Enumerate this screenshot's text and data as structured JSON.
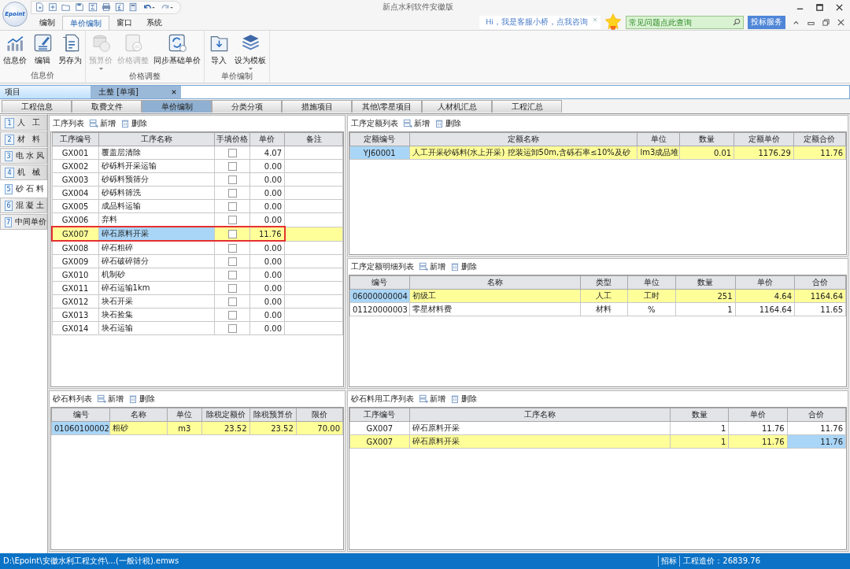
{
  "window": {
    "title": "新点水利软件安徽版"
  },
  "logo": "Epoint",
  "ribbon_tabs": [
    {
      "label": "编制",
      "selected": false
    },
    {
      "label": "单价编制",
      "selected": true
    },
    {
      "label": "窗口",
      "selected": false
    },
    {
      "label": "系统",
      "selected": false
    }
  ],
  "assistant": {
    "message": "Hi，我是客服小桥，点我咨询"
  },
  "search": {
    "placeholder": "常见问题点此查询"
  },
  "service_button": "投标服务",
  "ribbon_groups": [
    {
      "label": "信息价",
      "buttons": [
        {
          "label": "信息价",
          "disabled": false,
          "dropdown": false
        },
        {
          "label": "编辑",
          "disabled": false,
          "dropdown": false
        },
        {
          "label": "另存为",
          "disabled": false,
          "dropdown": false
        }
      ]
    },
    {
      "label": "价格调整",
      "buttons": [
        {
          "label": "预算价",
          "disabled": true,
          "dropdown": true
        },
        {
          "label": "价格调整",
          "disabled": true,
          "dropdown": false
        },
        {
          "label": "同步基础单价",
          "disabled": false,
          "dropdown": false
        }
      ]
    },
    {
      "label": "单价编制",
      "buttons": [
        {
          "label": "导入",
          "disabled": false,
          "dropdown": false
        },
        {
          "label": "设为模板",
          "disabled": false,
          "dropdown": true
        }
      ]
    }
  ],
  "doc_tabs": [
    {
      "label": "项目",
      "selected": false,
      "closable": false
    },
    {
      "label": "土整 [单项]",
      "selected": true,
      "closable": true
    }
  ],
  "sub_tabs": [
    {
      "label": "工程信息",
      "selected": false
    },
    {
      "label": "取费文件",
      "selected": false
    },
    {
      "label": "单价编制",
      "selected": true
    },
    {
      "label": "分类分项",
      "selected": false
    },
    {
      "label": "措施项目",
      "selected": false
    },
    {
      "label": "其他\\零星项目",
      "selected": false
    },
    {
      "label": "人材机汇总",
      "selected": false
    },
    {
      "label": "工程汇总",
      "selected": false
    }
  ],
  "side_tabs": [
    {
      "number": "1",
      "label": "人 工",
      "selected": false
    },
    {
      "number": "2",
      "label": "材 料",
      "selected": false
    },
    {
      "number": "3",
      "label": "电水风",
      "selected": false
    },
    {
      "number": "4",
      "label": "机 械",
      "selected": false
    },
    {
      "number": "5",
      "label": "砂石料",
      "selected": true
    },
    {
      "number": "6",
      "label": "混凝土",
      "selected": false
    },
    {
      "number": "7",
      "label": "中间单价",
      "selected": false
    }
  ],
  "process_list": {
    "title": "工序列表",
    "add": "新增",
    "delete": "删除",
    "columns": [
      "工序编号",
      "工序名称",
      "手填价格",
      "单价",
      "备注"
    ],
    "rows": [
      {
        "selected": false,
        "outlined": false,
        "cells": [
          {
            "text": "GX001",
            "focused": false
          },
          {
            "text": "覆盖层清除",
            "focused": false
          },
          {
            "checked": false
          },
          {
            "text": "4.07",
            "focused": false
          }
        ]
      },
      {
        "selected": false,
        "outlined": false,
        "cells": [
          {
            "text": "GX002",
            "focused": false
          },
          {
            "text": "砂砾料开采运输",
            "focused": false
          },
          {
            "checked": false
          },
          {
            "text": "0.00",
            "focused": false
          }
        ]
      },
      {
        "selected": false,
        "outlined": false,
        "cells": [
          {
            "text": "GX003",
            "focused": false
          },
          {
            "text": "砂砾料预筛分",
            "focused": false
          },
          {
            "checked": false
          },
          {
            "text": "0.00",
            "focused": false
          }
        ]
      },
      {
        "selected": false,
        "outlined": false,
        "cells": [
          {
            "text": "GX004",
            "focused": false
          },
          {
            "text": "砂砾料筛洗",
            "focused": false
          },
          {
            "checked": false
          },
          {
            "text": "0.00",
            "focused": false
          }
        ]
      },
      {
        "selected": false,
        "outlined": false,
        "cells": [
          {
            "text": "GX005",
            "focused": false
          },
          {
            "text": "成品料运输",
            "focused": false
          },
          {
            "checked": false
          },
          {
            "text": "0.00",
            "focused": false
          }
        ]
      },
      {
        "selected": false,
        "outlined": false,
        "cells": [
          {
            "text": "GX006",
            "focused": false
          },
          {
            "text": "弃料",
            "focused": false
          },
          {
            "checked": false
          },
          {
            "text": "0.00",
            "focused": false
          }
        ]
      },
      {
        "selected": true,
        "outlined": true,
        "cells": [
          {
            "text": "GX007",
            "focused": false
          },
          {
            "text": "碎石原料开采",
            "focused": true
          },
          {
            "checked": false
          },
          {
            "text": "11.76",
            "focused": false
          }
        ]
      },
      {
        "selected": false,
        "outlined": false,
        "cells": [
          {
            "text": "GX008",
            "focused": false
          },
          {
            "text": "碎石粗碎",
            "focused": false
          },
          {
            "checked": false
          },
          {
            "text": "0.00",
            "focused": false
          }
        ]
      },
      {
        "selected": false,
        "outlined": false,
        "cells": [
          {
            "text": "GX009",
            "focused": false
          },
          {
            "text": "碎石破碎筛分",
            "focused": false
          },
          {
            "checked": false
          },
          {
            "text": "0.00",
            "focused": false
          }
        ]
      },
      {
        "selected": false,
        "outlined": false,
        "cells": [
          {
            "text": "GX010",
            "focused": false
          },
          {
            "text": "机制砂",
            "focused": false
          },
          {
            "checked": false
          },
          {
            "text": "0.00",
            "focused": false
          }
        ]
      },
      {
        "selected": false,
        "outlined": false,
        "cells": [
          {
            "text": "GX011",
            "focused": false
          },
          {
            "text": "碎石运输1km",
            "focused": false
          },
          {
            "checked": false
          },
          {
            "text": "0.00",
            "focused": false
          }
        ]
      },
      {
        "selected": false,
        "outlined": false,
        "cells": [
          {
            "text": "GX012",
            "focused": false
          },
          {
            "text": "块石开采",
            "focused": false
          },
          {
            "checked": false
          },
          {
            "text": "0.00",
            "focused": false
          }
        ]
      },
      {
        "selected": false,
        "outlined": false,
        "cells": [
          {
            "text": "GX013",
            "focused": false
          },
          {
            "text": "块石捡集",
            "focused": false
          },
          {
            "checked": false
          },
          {
            "text": "0.00",
            "focused": false
          }
        ]
      },
      {
        "selected": false,
        "outlined": false,
        "cells": [
          {
            "text": "GX014",
            "focused": false
          },
          {
            "text": "块石运输",
            "focused": false
          },
          {
            "checked": false
          },
          {
            "text": "0.00",
            "focused": false
          }
        ]
      }
    ]
  },
  "quota_list": {
    "title": "工序定额列表",
    "add": "新增",
    "delete": "删除",
    "columns": [
      "定额编号",
      "定额名称",
      "单位",
      "数量",
      "定额单价",
      "定额合价"
    ],
    "rows": [
      {
        "selected": true,
        "cells": [
          {
            "text": "YJ60001",
            "focused": true
          },
          {
            "text": "人工开采砂砾料(水上开采) 挖装运卸50m,含砾石率≤10%及砂",
            "focused": false
          },
          {
            "text": "lm3成品堆",
            "focused": false
          },
          {
            "text": "0.01",
            "focused": false
          },
          {
            "text": "1176.29",
            "focused": false
          },
          {
            "text": "11.76",
            "focused": false
          }
        ]
      }
    ]
  },
  "quota_detail_list": {
    "title": "工序定额明细列表",
    "add": "新增",
    "delete": "删除",
    "columns": [
      "编号",
      "名称",
      "类型",
      "单位",
      "数量",
      "单价",
      "合价"
    ],
    "rows": [
      {
        "selected": true,
        "cells": [
          {
            "text": "06000000004",
            "focused": true
          },
          {
            "text": "初级工",
            "focused": false
          },
          {
            "text": "人工",
            "focused": false
          },
          {
            "text": "工时",
            "focused": false
          },
          {
            "text": "251",
            "focused": false
          },
          {
            "text": "4.64",
            "focused": false
          },
          {
            "text": "1164.64",
            "focused": false
          }
        ]
      },
      {
        "selected": false,
        "cells": [
          {
            "text": "01120000003",
            "focused": false
          },
          {
            "text": "零星材料费",
            "focused": false
          },
          {
            "text": "材料",
            "focused": false
          },
          {
            "text": "%",
            "focused": false
          },
          {
            "text": "1",
            "focused": false
          },
          {
            "text": "1164.64",
            "focused": false
          },
          {
            "text": "11.65",
            "focused": false
          }
        ]
      }
    ]
  },
  "gravel_list": {
    "title": "砂石料列表",
    "add": "新增",
    "delete": "删除",
    "columns": [
      "编号",
      "名称",
      "单位",
      "除税定额价",
      "除税预算价",
      "限价"
    ],
    "rows": [
      {
        "selected": true,
        "cells": [
          {
            "text": "01060100002",
            "focused": true
          },
          {
            "text": "粗砂",
            "focused": false
          },
          {
            "text": "m3",
            "focused": false
          },
          {
            "text": "23.52",
            "focused": false
          },
          {
            "text": "23.52",
            "focused": false
          },
          {
            "text": "70.00",
            "focused": false
          }
        ]
      }
    ]
  },
  "gravel_process_list": {
    "title": "砂石料用工序列表",
    "add": "新增",
    "delete": "删除",
    "columns": [
      "工序编号",
      "工序名称",
      "数量",
      "单价",
      "合价"
    ],
    "rows": [
      {
        "selected": false,
        "cells": [
          {
            "text": "GX007",
            "focused": false
          },
          {
            "text": "碎石原料开采",
            "focused": false
          },
          {
            "text": "1",
            "focused": false
          },
          {
            "text": "11.76",
            "focused": false
          },
          {
            "text": "11.76",
            "focused": false
          }
        ]
      },
      {
        "selected": true,
        "cells": [
          {
            "text": "GX007",
            "focused": false
          },
          {
            "text": "碎石原料开采",
            "focused": false
          },
          {
            "text": "1",
            "focused": false
          },
          {
            "text": "11.76",
            "focused": false
          },
          {
            "text": "11.76",
            "focused": true
          }
        ]
      }
    ]
  },
  "status_bar": {
    "path": "D:\\Epoint\\安徽水利工程文件\\…(一般计税).emws",
    "mode": "招标",
    "cost": "工程造价：26839.76"
  }
}
